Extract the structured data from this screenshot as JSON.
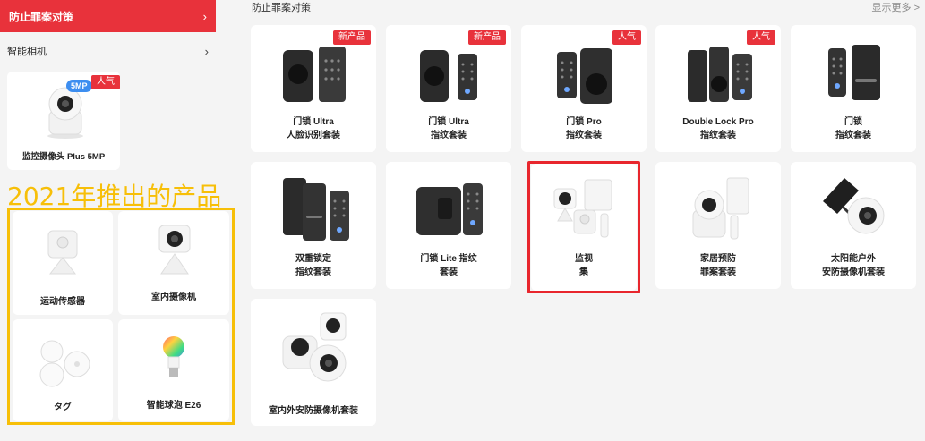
{
  "sidebar": {
    "active_label": "防止罪案对策",
    "item_label": "智能相机"
  },
  "sidebar_product": {
    "name": "监控摄像头 Plus 5MP",
    "badge_5mp": "5MP",
    "badge_hot": "人气"
  },
  "annotation": {
    "title": "2021年推出的产品"
  },
  "sidebar_grid": [
    {
      "label": "运动传感器"
    },
    {
      "label": "室内摄像机"
    },
    {
      "label": "タグ"
    },
    {
      "label": "智能球泡 E26"
    }
  ],
  "main": {
    "section_title": "防止罪案对策",
    "show_more": "显示更多 >"
  },
  "products": [
    {
      "line1": "门锁 Ultra",
      "line2": "人脸识别套装",
      "badge": "新产品"
    },
    {
      "line1": "门锁 Ultra",
      "line2": "指纹套装",
      "badge": "新产品"
    },
    {
      "line1": "门锁 Pro",
      "line2": "指纹套装",
      "badge": "人气"
    },
    {
      "line1": "Double Lock Pro",
      "line2": "指纹套装",
      "badge": "人气"
    },
    {
      "line1": "门锁",
      "line2": "指纹套装",
      "badge": ""
    },
    {
      "line1": "双重锁定",
      "line2": "指纹套装",
      "badge": ""
    },
    {
      "line1": "门锁 Lite 指纹",
      "line2": "套装",
      "badge": ""
    },
    {
      "line1": "监视",
      "line2": "集",
      "badge": ""
    },
    {
      "line1": "家居预防",
      "line2": "罪案套装",
      "badge": ""
    },
    {
      "line1": "太阳能户外",
      "line2": "安防摄像机套装",
      "badge": ""
    },
    {
      "line1": "室内外安防摄像机套装",
      "line2": "",
      "badge": ""
    }
  ],
  "colors": {
    "accent_red": "#e8323b",
    "highlight_red": "#e8262d",
    "annotation_yellow": "#f7bf08",
    "badge_blue": "#3d8ef0"
  }
}
